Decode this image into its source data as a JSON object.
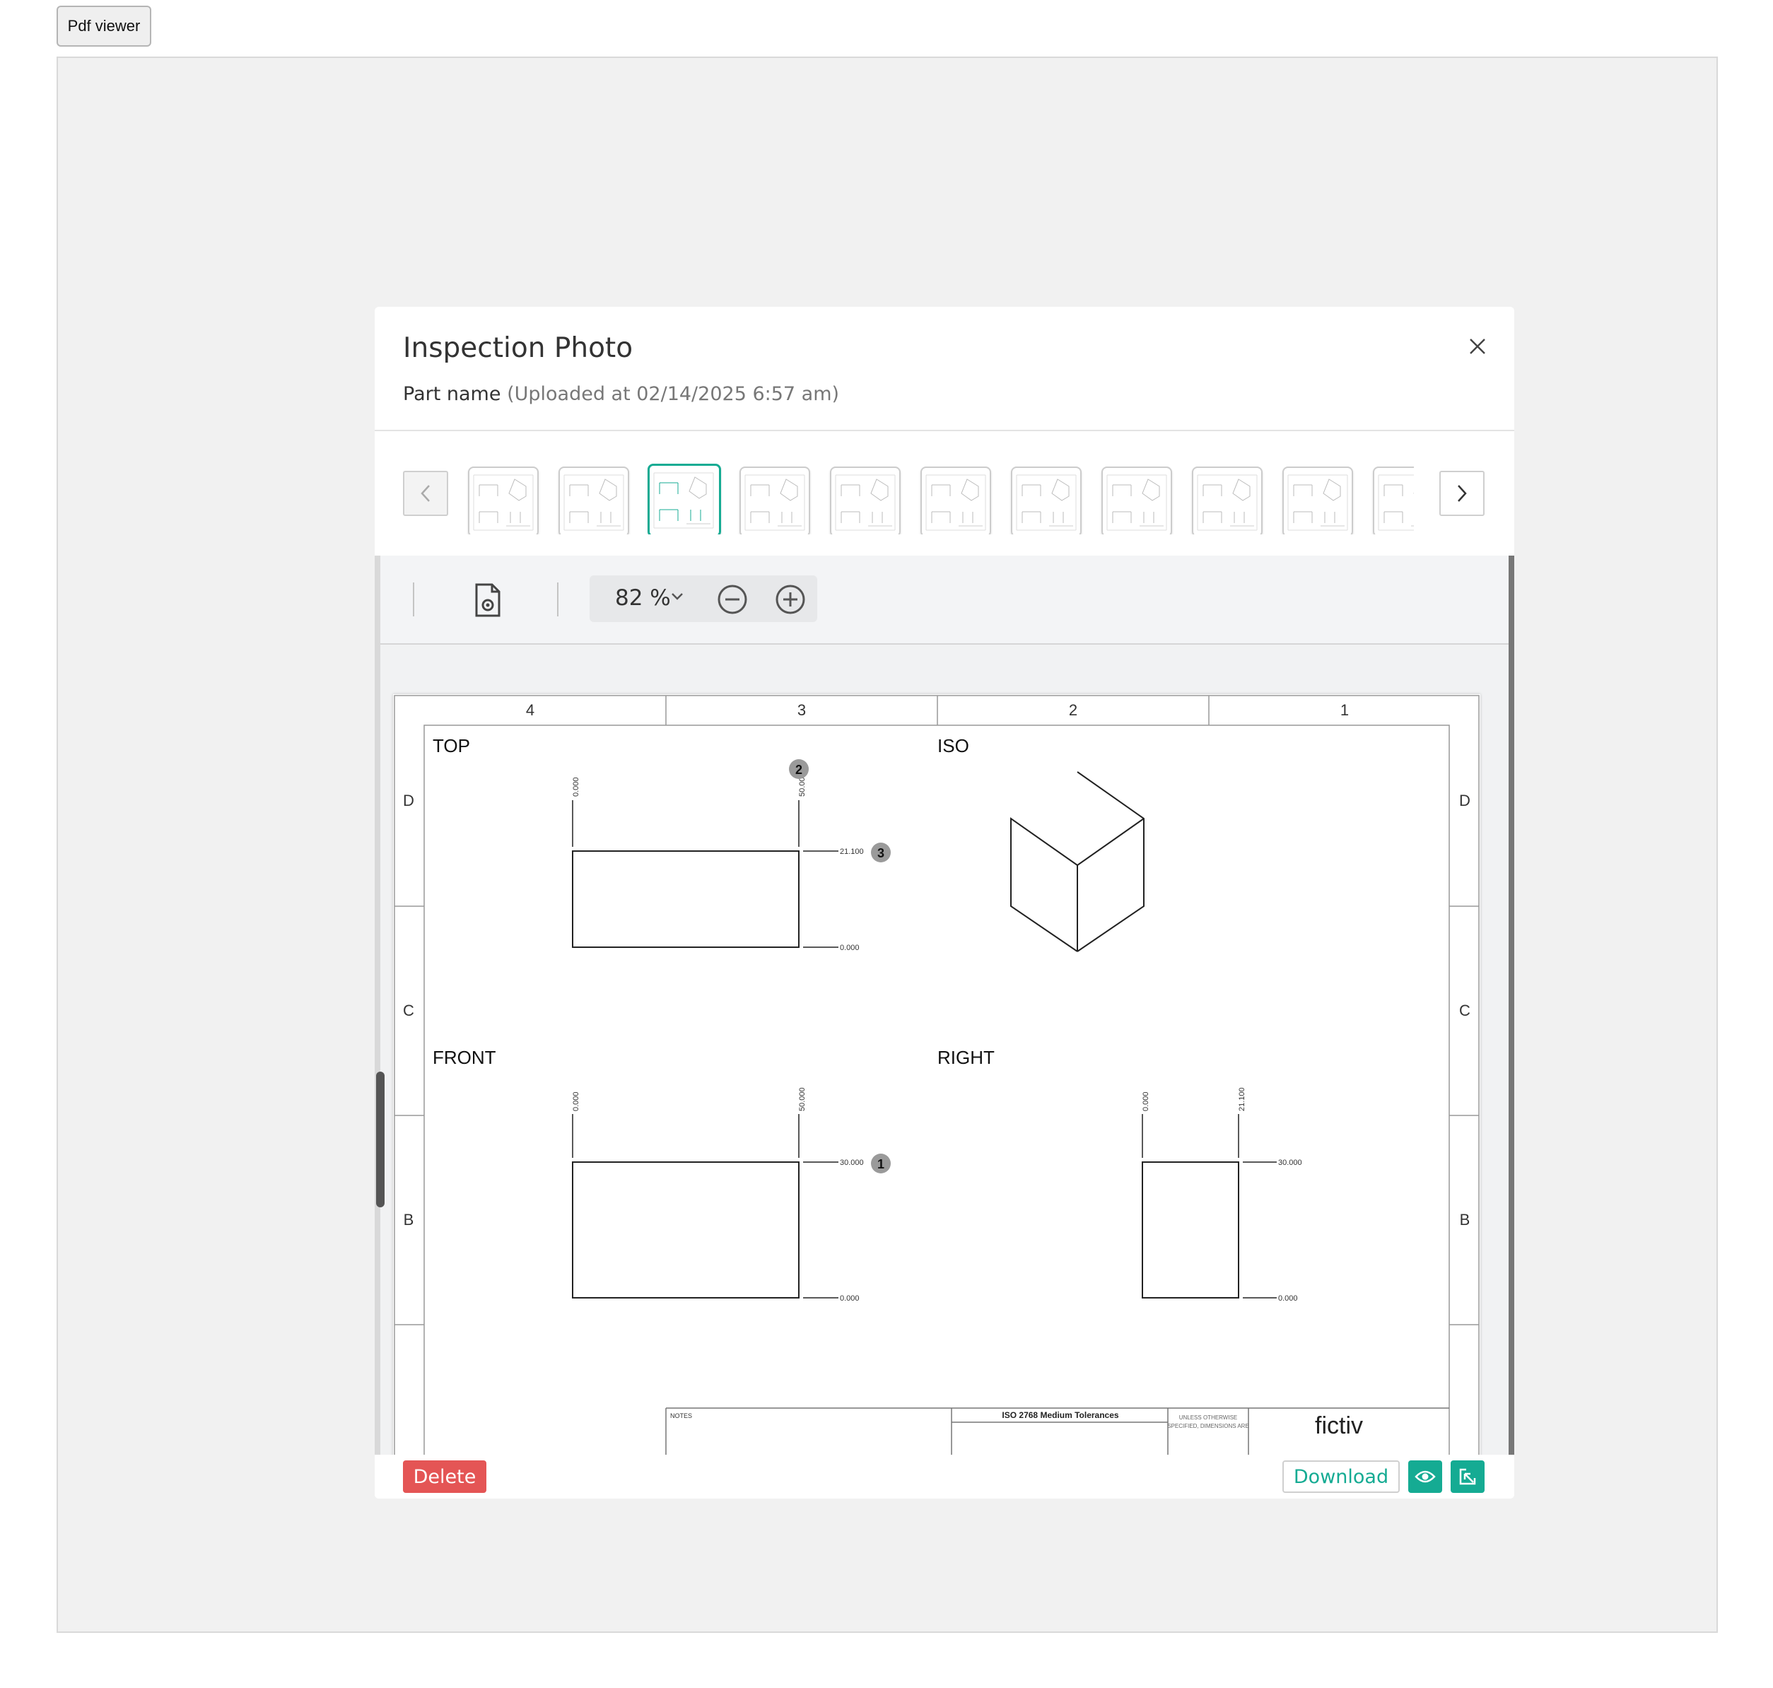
{
  "top_button": {
    "label": "Pdf viewer"
  },
  "modal": {
    "title": "Inspection Photo",
    "part_name": "Part name",
    "uploaded": "(Uploaded at 02/14/2025 6:57 am)",
    "close_label": "X"
  },
  "thumbnails": {
    "prev": "<",
    "next": ">",
    "count": 11,
    "selected_index": 2
  },
  "viewer": {
    "zoom": "82 %"
  },
  "drawing": {
    "columns": [
      "4",
      "3",
      "2",
      "1"
    ],
    "rows": [
      "D",
      "C",
      "B"
    ],
    "views": {
      "top": "TOP",
      "iso": "ISO",
      "front": "FRONT",
      "right": "RIGHT"
    },
    "dims": {
      "top_x0": "0.000",
      "top_x1": "50.000",
      "top_y1": "21.100",
      "top_y0": "0.000",
      "front_x0": "0.000",
      "front_x1": "50.000",
      "front_y1": "30.000",
      "front_y0": "0.000",
      "right_x0": "0.000",
      "right_x1": "21.100",
      "right_y1": "30.000",
      "right_y0": "0.000"
    },
    "balloons": {
      "b1": "1",
      "b2": "2",
      "b3": "3"
    },
    "title_block": {
      "notes": "NOTES",
      "tolerances": "ISO 2768 Medium Tolerances",
      "unless": "UNLESS OTHERWISE",
      "specified": "SPECIFIED, DIMENSIONS ARE",
      "logo": "fictiv"
    }
  },
  "footer": {
    "delete": "Delete",
    "download": "Download"
  },
  "colors": {
    "accent": "#15ab93",
    "danger": "#e45555"
  }
}
